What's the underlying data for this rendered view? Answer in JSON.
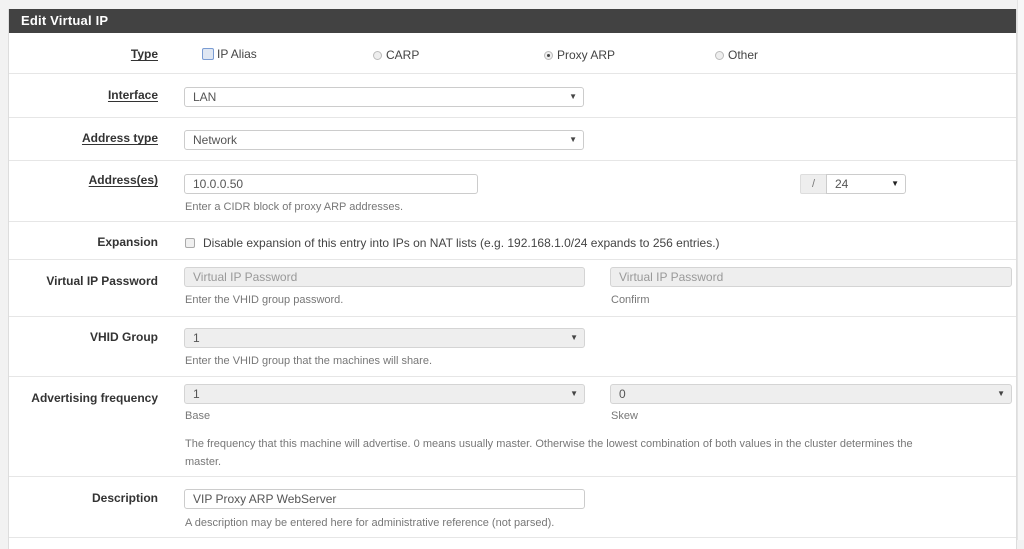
{
  "panel": {
    "title": "Edit Virtual IP"
  },
  "type": {
    "label": "Type",
    "options": [
      {
        "label": "IP Alias",
        "control": "checkbox-focus",
        "selected": false
      },
      {
        "label": "CARP",
        "control": "radio",
        "selected": false
      },
      {
        "label": "Proxy ARP",
        "control": "radio",
        "selected": true
      },
      {
        "label": "Other",
        "control": "radio",
        "selected": false
      }
    ]
  },
  "interface": {
    "label": "Interface",
    "value": "LAN"
  },
  "address_type": {
    "label": "Address type",
    "value": "Network"
  },
  "addresses": {
    "label": "Address(es)",
    "value": "10.0.0.50",
    "help": "Enter a CIDR block of proxy ARP addresses.",
    "cidr_separator": "/",
    "cidr_value": "24"
  },
  "expansion": {
    "label": "Expansion",
    "checked": false,
    "text": "Disable expansion of this entry into IPs on NAT lists (e.g. 192.168.1.0/24 expands to 256 entries.)"
  },
  "vip_password": {
    "label": "Virtual IP Password",
    "placeholder": "Virtual IP Password",
    "help": "Enter the VHID group password.",
    "confirm_placeholder": "Virtual IP Password",
    "confirm_help": "Confirm"
  },
  "vhid_group": {
    "label": "VHID Group",
    "value": "1",
    "help": "Enter the VHID group that the machines will share."
  },
  "advertising_frequency": {
    "label": "Advertising frequency",
    "base_value": "1",
    "base_help": "Base",
    "skew_value": "0",
    "skew_help": "Skew",
    "help_line1": "The frequency that this machine will advertise. 0 means usually master. Otherwise the lowest combination of both values in the cluster determines the",
    "help_line2": "master."
  },
  "description": {
    "label": "Description",
    "value": "VIP Proxy ARP WebServer",
    "help": "A description may be entered here for administrative reference (not parsed)."
  }
}
